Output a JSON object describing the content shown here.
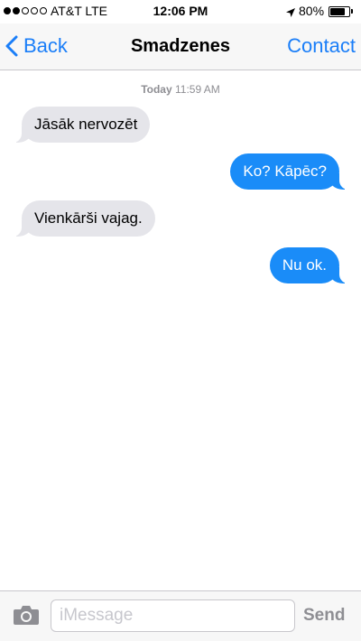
{
  "status_bar": {
    "carrier": "AT&T LTE",
    "time": "12:06 PM",
    "battery_percent": "80%",
    "battery_level": 0.8,
    "signal_bars_filled": 2,
    "signal_bars_total": 5,
    "icons": [
      "signal-dots-icon",
      "location-arrow-icon",
      "battery-icon"
    ]
  },
  "nav": {
    "back_label": "Back",
    "title": "Smadzenes",
    "contact_label": "Contact",
    "accent_color": "#1a7ef8"
  },
  "conversation": {
    "timestamp_day": "Today",
    "timestamp_time": "11:59 AM",
    "messages": [
      {
        "direction": "incoming",
        "text": "Jāsāk nervozēt"
      },
      {
        "direction": "outgoing",
        "text": "Ko? Kāpēc?"
      },
      {
        "direction": "incoming",
        "text": "Vienkārši vajag."
      },
      {
        "direction": "outgoing",
        "text": "Nu ok."
      }
    ],
    "incoming_color": "#e5e5ea",
    "outgoing_color": "#1a8cf8"
  },
  "composer": {
    "camera_icon": "camera-icon",
    "placeholder": "iMessage",
    "value": "",
    "send_label": "Send"
  }
}
